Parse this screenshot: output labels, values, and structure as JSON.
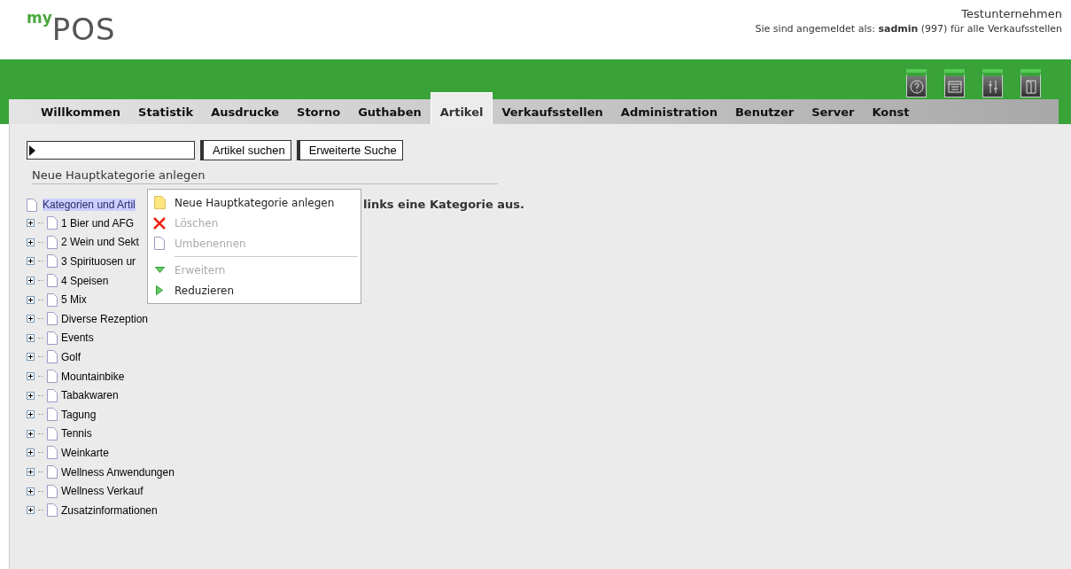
{
  "header": {
    "logo_prefix": "my",
    "logo_main": "POS",
    "company": "Testunternehmen",
    "login_prefix": "Sie sind angemeldet als: ",
    "login_user": "sadmin",
    "login_suffix": " (997) für alle Verkaufsstellen"
  },
  "toolbar": [
    {
      "kind": "help"
    },
    {
      "kind": "window"
    },
    {
      "kind": "settings"
    },
    {
      "kind": "logout"
    }
  ],
  "tabs": [
    {
      "label": "Willkommen",
      "selected": false
    },
    {
      "label": "Statistik",
      "selected": false
    },
    {
      "label": "Ausdrucke",
      "selected": false
    },
    {
      "label": "Storno",
      "selected": false
    },
    {
      "label": "Guthaben",
      "selected": false
    },
    {
      "label": "Artikel",
      "selected": true
    },
    {
      "label": "Verkaufsstellen",
      "selected": false
    },
    {
      "label": "Administration",
      "selected": false
    },
    {
      "label": "Benutzer",
      "selected": false
    },
    {
      "label": "Server",
      "selected": false
    },
    {
      "label": "Konst",
      "selected": false
    }
  ],
  "search": {
    "buttons": [
      "Artikel suchen",
      "Erweiterte Suche"
    ]
  },
  "section_link": "Neue Hauptkategorie anlegen",
  "message": "links eine Kategorie aus.",
  "tree": {
    "label": "Kategorien und Artil",
    "selected": true,
    "children": [
      {
        "label": "1 Bier und AFG",
        "expanded": false
      },
      {
        "label": "2 Wein und Sekt",
        "expanded": false
      },
      {
        "label": "3 Spirituosen ur",
        "expanded": false
      },
      {
        "label": "4 Speisen",
        "expanded": false
      },
      {
        "label": "5 Mix",
        "expanded": false
      },
      {
        "label": "Diverse Rezeption",
        "expanded": false
      },
      {
        "label": "Events",
        "expanded": false
      },
      {
        "label": "Golf",
        "expanded": false
      },
      {
        "label": "Mountainbike",
        "expanded": false
      },
      {
        "label": "Tabakwaren",
        "expanded": false
      },
      {
        "label": "Tagung",
        "expanded": false
      },
      {
        "label": "Tennis",
        "expanded": false
      },
      {
        "label": "Weinkarte",
        "expanded": false
      },
      {
        "label": "Wellness Anwendungen",
        "expanded": false
      },
      {
        "label": "Wellness Verkauf",
        "expanded": false
      },
      {
        "label": "Zusatzinformationen",
        "expanded": false
      }
    ]
  },
  "context_menu": [
    {
      "kind": "new",
      "label": "Neue Hauptkategorie anlegen",
      "disabled": false
    },
    {
      "kind": "delete",
      "label": "Löschen",
      "disabled": true
    },
    {
      "kind": "rename",
      "label": "Umbenennen",
      "disabled": true
    },
    {
      "kind": "separator"
    },
    {
      "kind": "expand",
      "label": "Erweitern",
      "disabled": true
    },
    {
      "kind": "collapse",
      "label": "Reduzieren",
      "disabled": false
    }
  ]
}
